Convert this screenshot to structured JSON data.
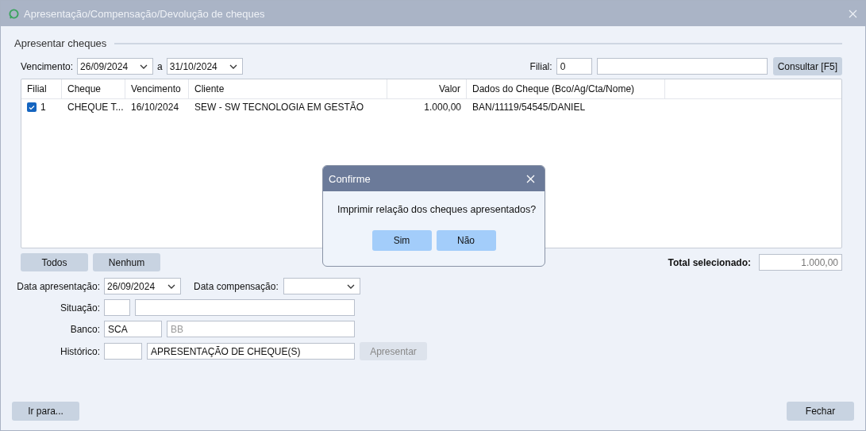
{
  "window": {
    "title": "Apresentação/Compensação/Devolução de cheques"
  },
  "group": {
    "title": "Apresentar cheques"
  },
  "filter": {
    "label": "Vencimento:",
    "from": "26/09/2024",
    "separator": "a",
    "to": "31/10/2024",
    "filial_label": "Filial:",
    "filial_code": "0",
    "consult_button": "Consultar [F5]"
  },
  "table": {
    "columns": [
      {
        "label": "Filial",
        "kind": "text"
      },
      {
        "label": "Cheque",
        "kind": "text"
      },
      {
        "label": "Vencimento",
        "kind": "text"
      },
      {
        "label": "Cliente",
        "kind": "text"
      },
      {
        "label": "Valor",
        "kind": "number"
      },
      {
        "label": "Dados do Cheque (Bco/Ag/Cta/Nome)",
        "kind": "text"
      }
    ],
    "rows": [
      {
        "checked": true,
        "cells": [
          "1",
          "CHEQUE T...",
          "16/10/2024",
          "SEW - SW TECNOLOGIA EM GESTÃO",
          "1.000,00",
          "BAN/11119/54545/DANIEL"
        ]
      }
    ]
  },
  "selection_buttons": [
    "Todos",
    "Nenhum"
  ],
  "total": {
    "label": "Total selecionado:",
    "value": "1.000,00"
  },
  "form": {
    "date_presentation": {
      "label": "Data apresentação:",
      "value": "26/09/2024"
    },
    "date_compensation": {
      "label": "Data compensação:"
    },
    "situacao": {
      "label": "Situação:"
    },
    "banco": {
      "label": "Banco:",
      "code": "SCA",
      "placeholder": "BB"
    },
    "historico": {
      "label": "Histórico:",
      "name": "APRESENTAÇÃO DE CHEQUE(S)"
    },
    "apresentar_button": {
      "label": "Apresentar",
      "disabled": true
    }
  },
  "footer": {
    "goto_button": "Ir para...",
    "close_button": "Fechar"
  },
  "dialog": {
    "title": "Confirme",
    "message": "Imprimir relação dos cheques apresentados?",
    "buttons": [
      "Sim",
      "Não"
    ]
  }
}
